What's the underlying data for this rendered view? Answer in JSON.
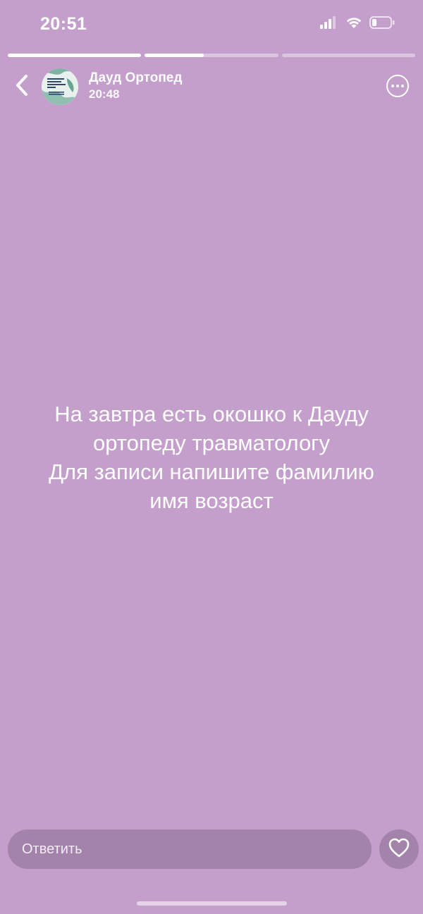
{
  "status_bar": {
    "time": "20:51",
    "icons": [
      "cellular-signal-icon",
      "wifi-icon",
      "battery-icon"
    ]
  },
  "progress": {
    "segments": [
      1.0,
      0.44,
      0.0
    ]
  },
  "header": {
    "author_name": "Дауд Ортопед",
    "post_time": "20:48",
    "back_icon": "chevron-left-icon",
    "more_icon": "more-options-icon"
  },
  "story": {
    "lines": [
      "На завтра есть окошко к Дауду",
      "ортопеду травматологу",
      "Для записи напишите фамилию",
      "имя возраст"
    ]
  },
  "reply": {
    "placeholder": "Ответить",
    "like_icon": "heart-icon"
  },
  "colors": {
    "background": "#c49fcc",
    "input_background": "#a483aa",
    "text": "#ffffff"
  }
}
